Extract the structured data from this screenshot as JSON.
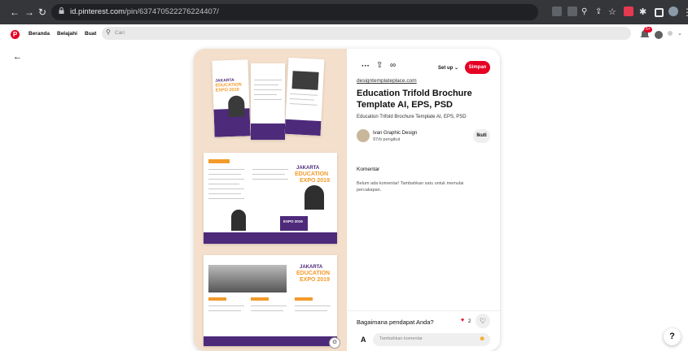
{
  "browser": {
    "url_host": "id.pinterest.com",
    "url_path": "/pin/637470522276224407/"
  },
  "header": {
    "nav": [
      "Beranda",
      "Belajahi",
      "Buat"
    ],
    "search_placeholder": "Cari",
    "notif_count": "5+"
  },
  "pin": {
    "save_dropdown": "Set up",
    "save_button": "Simpan",
    "source_link": "designtemplateplace.com",
    "title": "Education Trifold Brochure Template AI, EPS, PSD",
    "description": "Education Trifold Brochure Template AI, EPS, PSD",
    "author_name": "Ivan Graphic Design",
    "author_followers": "97rb pengikut",
    "follow_button": "Ikuti",
    "comments_heading": "Komentar",
    "comments_empty": "Belum ada komentar! Tambahkan satu untuk memulai percakapan.",
    "prompt": "Bagaimana pendapat Anda?",
    "reaction_count": "2",
    "comment_placeholder": "Tambahkan komentar",
    "avatar_letter": "A"
  },
  "brochure": {
    "heading1": "JAKARTA",
    "heading2": "EDUCATION",
    "heading3": "EXPO 2019"
  },
  "help_label": "?"
}
